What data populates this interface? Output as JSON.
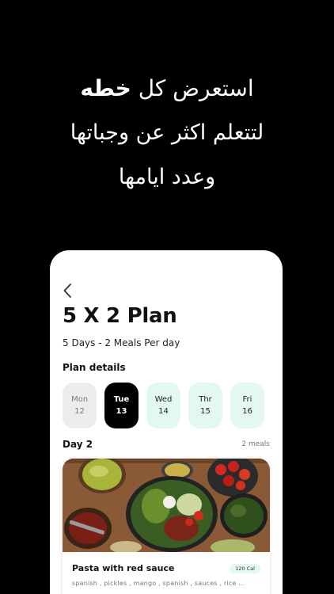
{
  "headline": {
    "line1_prefix": "استعرض كل",
    "line1_bold": "خطه",
    "line2": "لتتعلم اكثر عن وجباتها",
    "line3": "وعدد ايامها"
  },
  "plan": {
    "back_icon": "chevron-left-icon",
    "title": "5 X 2 Plan",
    "subtitle": "5 Days - 2 Meals Per day",
    "details_label": "Plan details",
    "days": [
      {
        "name": "Mon",
        "date": "12",
        "state": "past"
      },
      {
        "name": "Tue",
        "date": "13",
        "state": "active"
      },
      {
        "name": "Wed",
        "date": "14",
        "state": "future"
      },
      {
        "name": "Thr",
        "date": "15",
        "state": "future"
      },
      {
        "name": "Fri",
        "date": "16",
        "state": "future"
      }
    ],
    "day_title": "Day 2",
    "meals_count": "2 meals"
  },
  "meal": {
    "name": "Pasta with red sauce",
    "calories": "120 Cal",
    "ingredients": "spanish , pickles , mango , spanish , sauces , rice ..."
  },
  "colors": {
    "background": "#000000",
    "accent_mint": "#e3f8f1",
    "active_day": "#000000",
    "past_day": "#ececec"
  }
}
